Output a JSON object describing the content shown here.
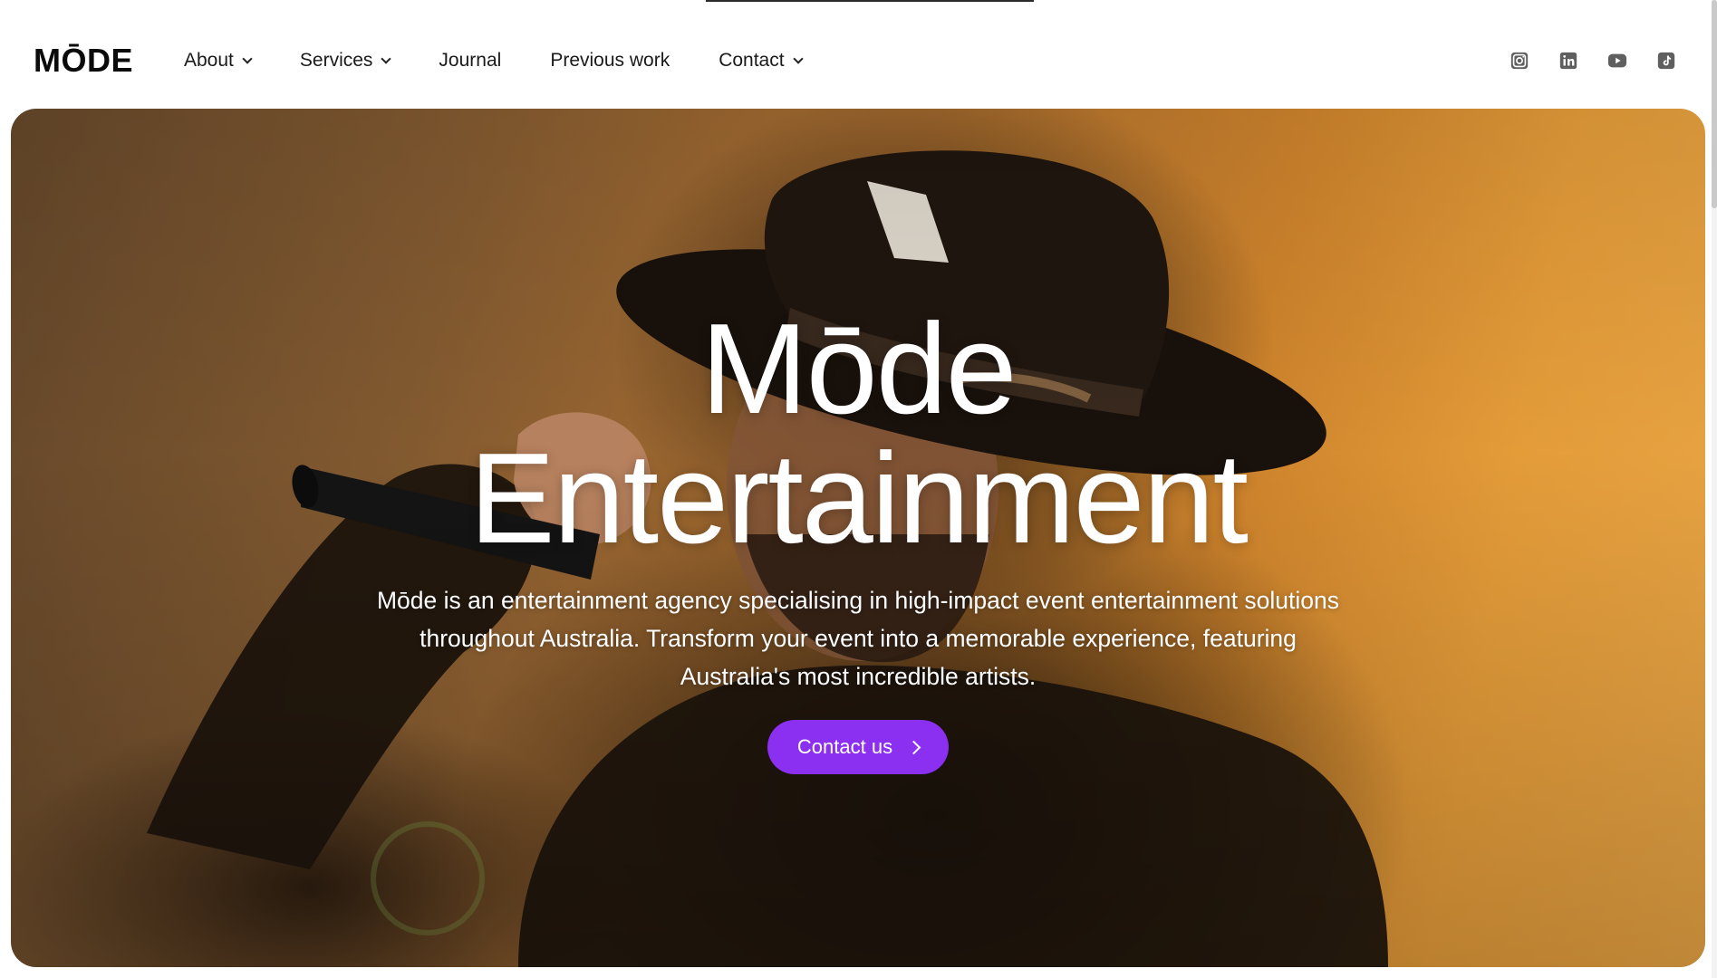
{
  "brand": {
    "logo_text": "MŌDE"
  },
  "nav": {
    "items": [
      {
        "label": "About",
        "has_dropdown": true
      },
      {
        "label": "Services",
        "has_dropdown": true
      },
      {
        "label": "Journal",
        "has_dropdown": false
      },
      {
        "label": "Previous work",
        "has_dropdown": false
      },
      {
        "label": "Contact",
        "has_dropdown": true
      }
    ],
    "socials": [
      "instagram-icon",
      "linkedin-icon",
      "youtube-icon",
      "tiktok-icon"
    ]
  },
  "hero": {
    "title_line1": "Mōde",
    "title_line2": "Entertainment",
    "description": "Mōde is an entertainment agency specialising in high-impact event entertainment solutions throughout Australia.  Transform your event into a memorable experience, featuring Australia's most incredible artists.",
    "cta_label": "Contact us"
  },
  "colors": {
    "accent": "#8b2ff0",
    "hero_gradient_start": "#6a4b2c",
    "hero_gradient_end": "#f4ad48",
    "text_dark": "#1a1a1a"
  }
}
